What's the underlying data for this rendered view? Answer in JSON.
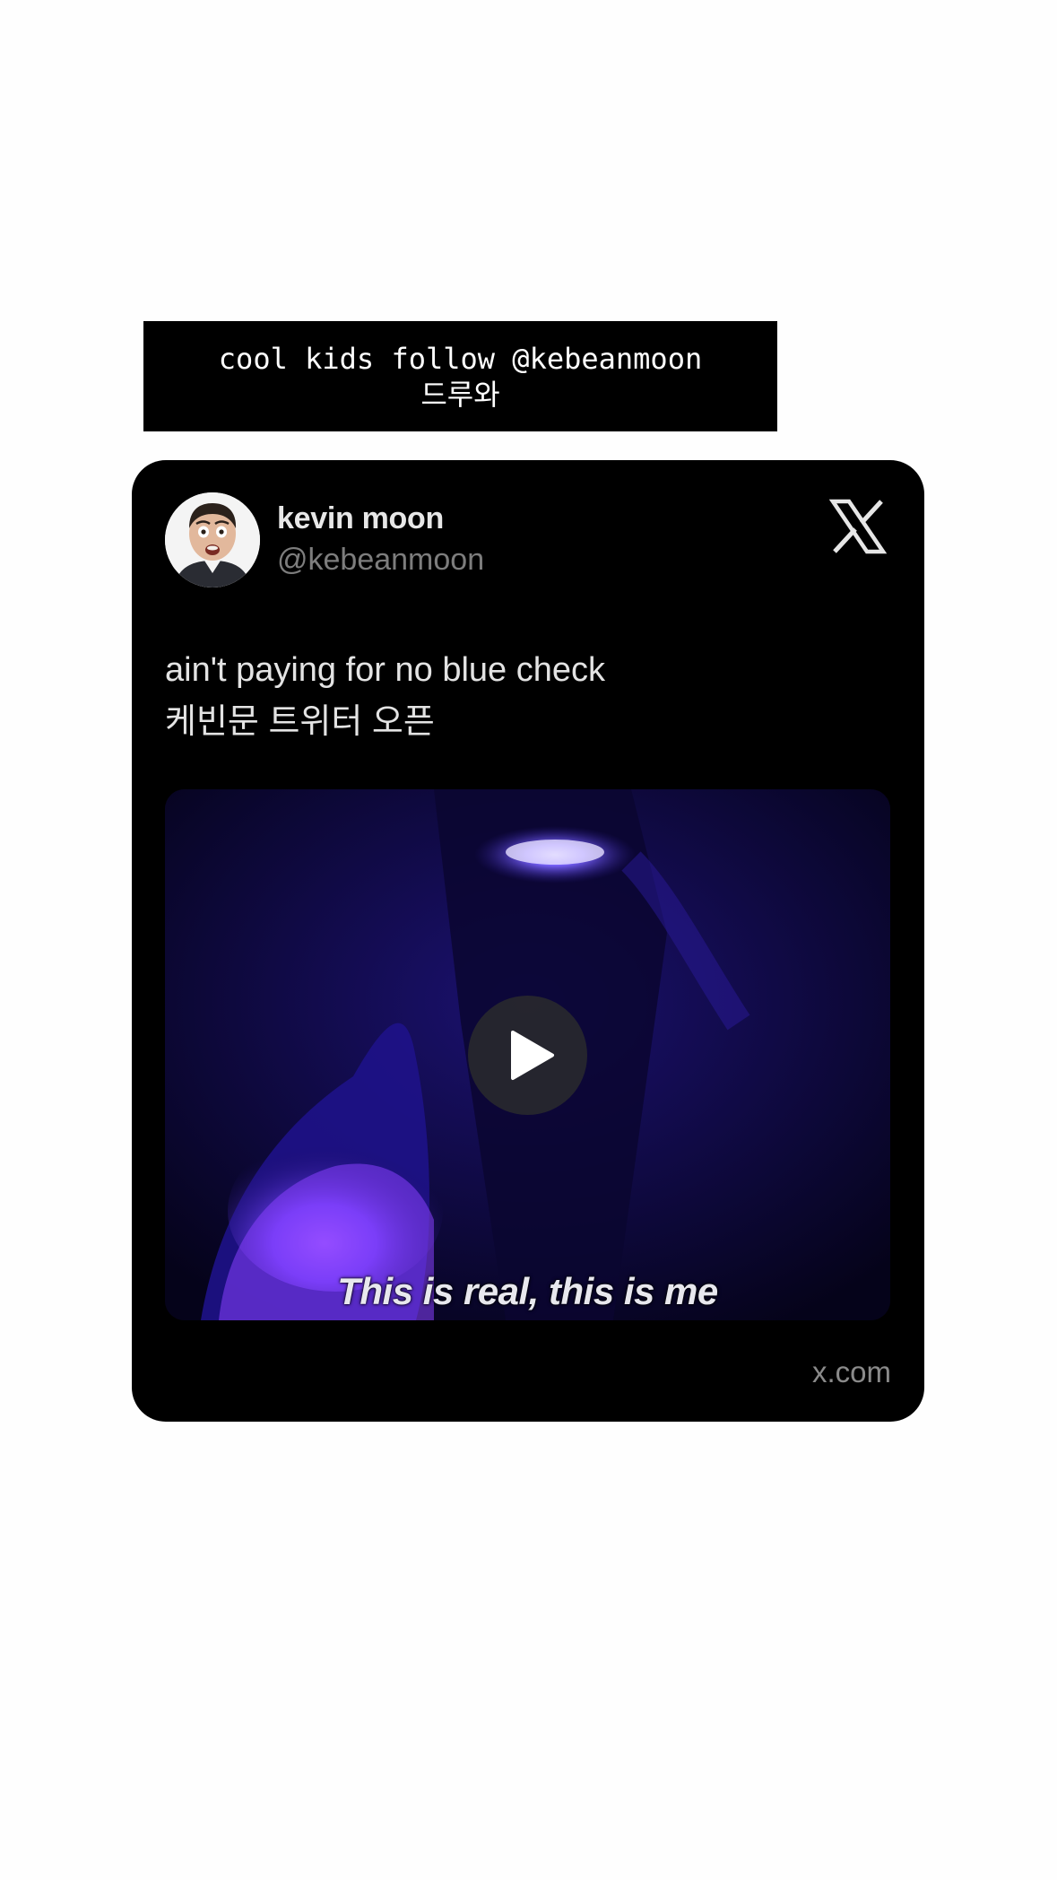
{
  "caption": {
    "line1": "cool kids follow @kebeanmoon",
    "line2": "드루와"
  },
  "tweet": {
    "author_name": "kevin moon",
    "author_handle": "@kebeanmoon",
    "platform_icon": "x-logo-icon",
    "text_line1": "ain't paying for no blue check",
    "text_line2": "케빈문 트위터 오픈",
    "media": {
      "type": "video",
      "subtitle": "This is real, this is me",
      "play_icon": "play-icon"
    },
    "source": "x.com"
  },
  "colors": {
    "card_background": "#000000",
    "media_glow": "#6a4cff",
    "media_glow_secondary": "#9a3cff"
  }
}
